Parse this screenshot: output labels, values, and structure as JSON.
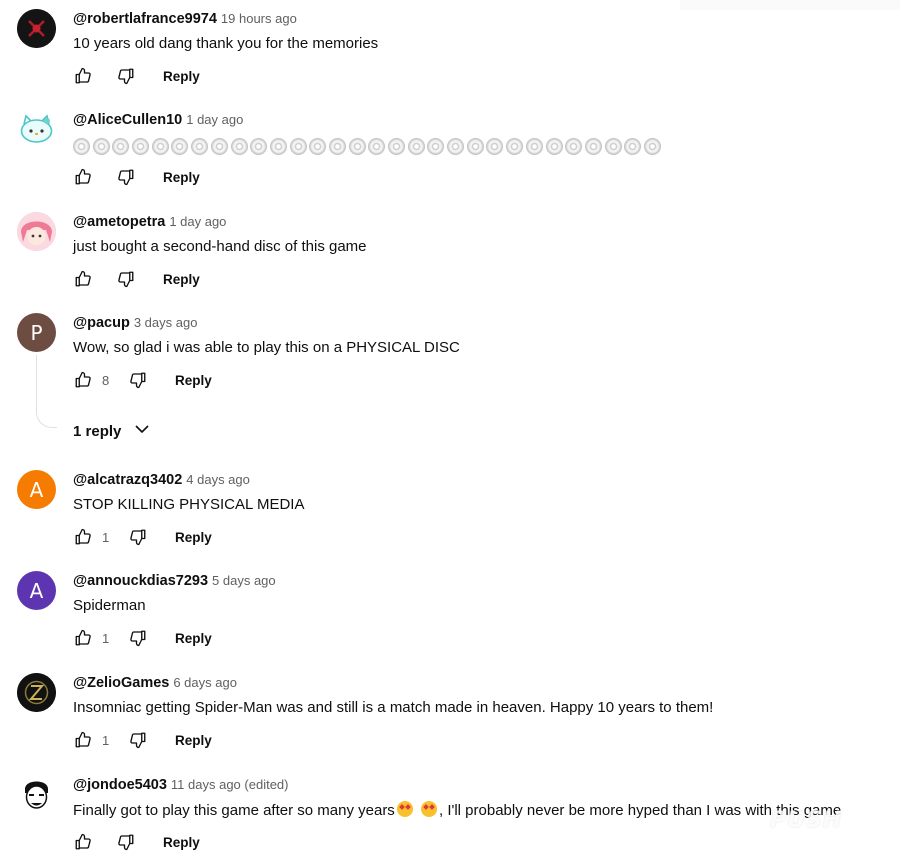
{
  "comments": [
    {
      "author": "@robertlafrance9974",
      "time": "19 hours ago",
      "text": "10 years old dang thank you for the memories",
      "likes": "",
      "reply_label": "Reply",
      "avatar_letter": "",
      "avatar_color": "#1a1a1a"
    },
    {
      "author": "@AliceCullen10",
      "time": "1 day ago",
      "text": "",
      "disc_emoji_count": 30,
      "likes": "",
      "reply_label": "Reply",
      "avatar_letter": "",
      "avatar_color": "#ffffff"
    },
    {
      "author": "@ametopetra",
      "time": "1 day ago",
      "text": "just bought a second-hand disc of this game",
      "likes": "",
      "reply_label": "Reply",
      "avatar_letter": "",
      "avatar_color": "#f6c4cf"
    },
    {
      "author": "@pacup",
      "time": "3 days ago",
      "text": "Wow, so glad i was able to play this on a PHYSICAL DISC",
      "likes": "8",
      "reply_label": "Reply",
      "avatar_letter": "P",
      "avatar_color": "#6d4c41"
    },
    {
      "author": "@alcatrazq3402",
      "time": "4 days ago",
      "text": "STOP KILLING PHYSICAL MEDIA",
      "likes": "1",
      "reply_label": "Reply",
      "avatar_letter": "A",
      "avatar_color": "#f57c00"
    },
    {
      "author": "@annouckdias7293",
      "time": "5 days ago",
      "text": "Spiderman",
      "likes": "1",
      "reply_label": "Reply",
      "avatar_letter": "A",
      "avatar_color": "#5e35b1"
    },
    {
      "author": "@ZelioGames",
      "time": "6 days ago",
      "text": "Insomniac getting Spider-Man was and still is a match made in heaven. Happy 10 years to them!",
      "likes": "1",
      "reply_label": "Reply",
      "avatar_letter": "",
      "avatar_color": "#111111"
    },
    {
      "author": "@jondoe5403",
      "time": "11 days ago (edited)",
      "text_before_emoji": "Finally got to play this game after so many years",
      "text_after_emoji": ", I'll probably never be more hyped than I was with this game",
      "likes": "",
      "reply_label": "Reply",
      "avatar_letter": "",
      "avatar_color": "#ffffff"
    }
  ],
  "replies_toggle": {
    "label": "1 reply"
  },
  "watermark": "PUSH",
  "colors": {
    "text": "#0f0f0f",
    "secondary": "#606060",
    "divider": "#e0e0e0"
  }
}
